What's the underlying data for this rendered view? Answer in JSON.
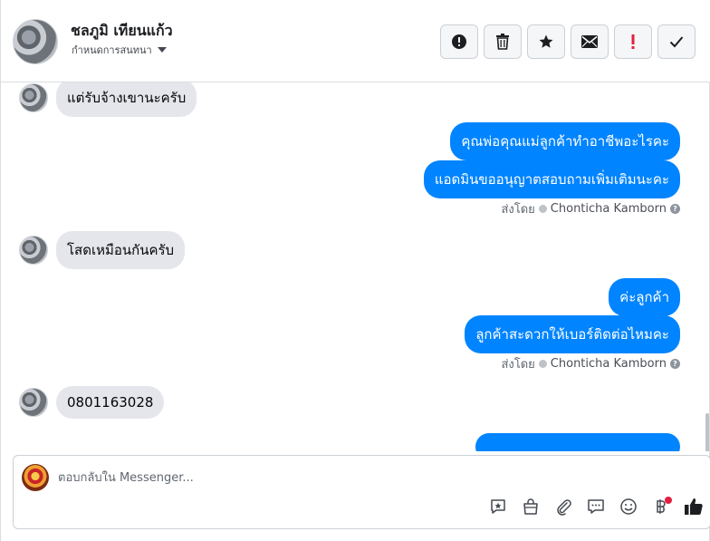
{
  "header": {
    "contact_name": "ชลภูมิ เทียนแก้ว",
    "assign_label": "กำหนดการสนทนา",
    "toolbar": [
      {
        "name": "spam-button",
        "icon": "alert-circle-icon"
      },
      {
        "name": "delete-button",
        "icon": "trash-icon"
      },
      {
        "name": "star-button",
        "icon": "star-icon"
      },
      {
        "name": "mark-unread-button",
        "icon": "envelope-icon"
      },
      {
        "name": "follow-up-button",
        "icon": "exclamation-icon"
      },
      {
        "name": "mark-done-button",
        "icon": "check-icon"
      }
    ]
  },
  "messages": {
    "incoming_1": "แต่รับจ้างเขานะครับ",
    "outgoing_1": "คุณพ่อคุณแม่ลูกค้าทำอาชีพอะไรคะ",
    "outgoing_2": "แอดมินขออนุญาตสอบถามเพิ่มเติมนะคะ",
    "incoming_2": "โสดเหมือนกันครับ",
    "outgoing_3": "ค่ะลูกค้า",
    "outgoing_4": "ลูกค้าสะดวกให้เบอร์ติดต่อไหมคะ",
    "incoming_3": "0801163028",
    "sent_by_label": "ส่งโดย",
    "sent_by_agent": "Chonticha Kamborn",
    "help_glyph": "?"
  },
  "composer": {
    "placeholder": "ตอบกลับใน Messenger...",
    "tools": [
      "saved-reply-icon",
      "shop-bag-icon",
      "attachment-icon",
      "chat-bubble-icon",
      "emoji-icon",
      "baht-payment-icon",
      "like-icon"
    ]
  },
  "colors": {
    "accent": "#0084ff",
    "incoming_bubble": "#e4e6eb",
    "follow_up_red": "#e41e3f"
  }
}
